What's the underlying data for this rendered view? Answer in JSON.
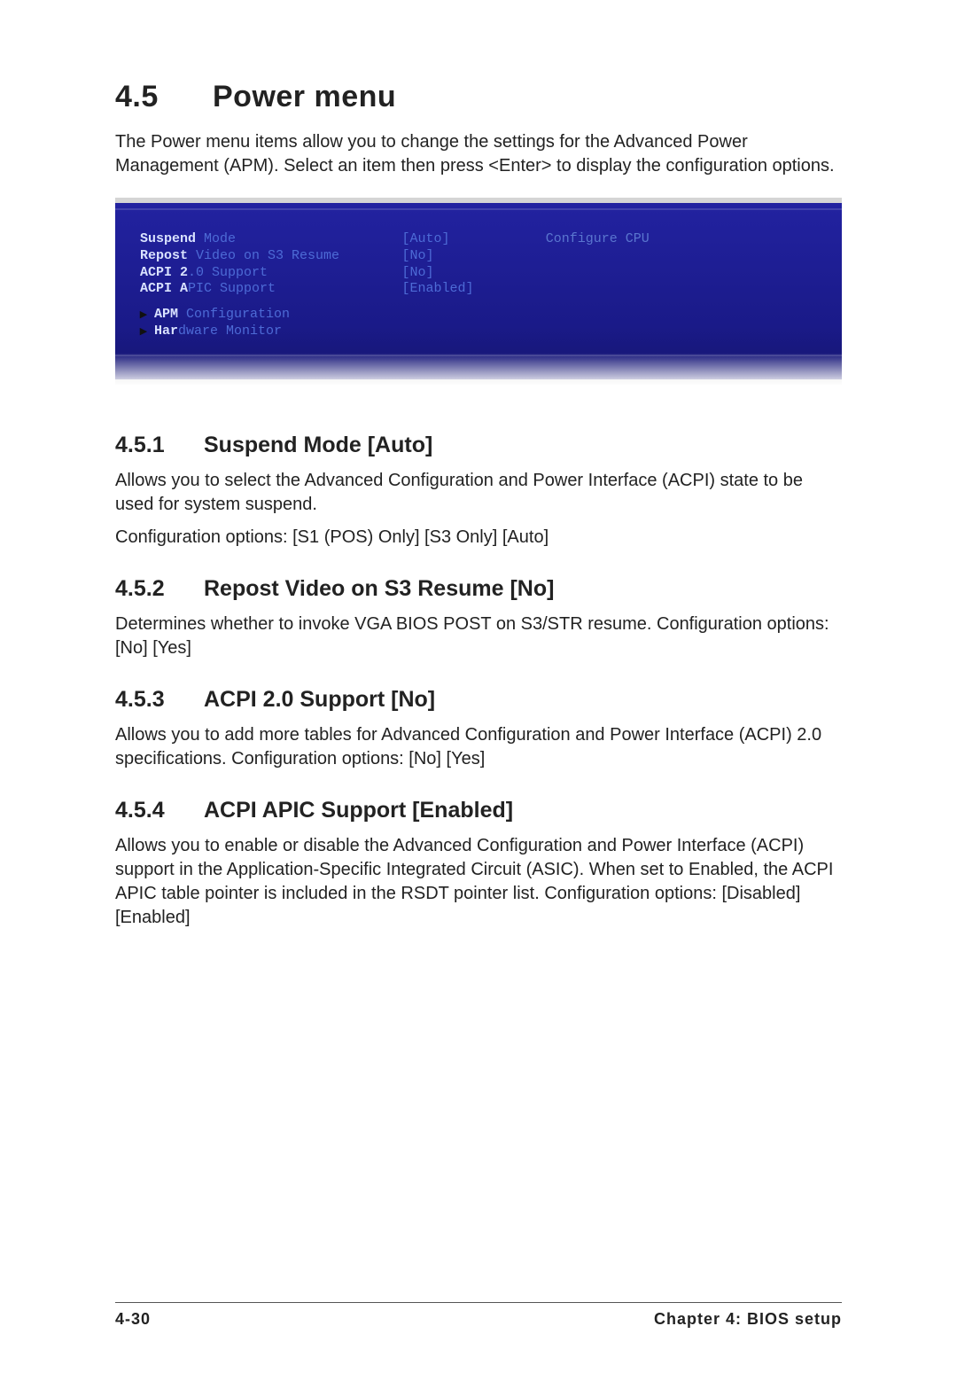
{
  "section": {
    "number": "4.5",
    "title": "Power menu",
    "intro": "The Power menu items allow you to change the settings for the Advanced Power Management (APM). Select an item then press <Enter> to display the configuration options."
  },
  "bios": {
    "help": "Configure CPU",
    "items": [
      {
        "bold": "Suspend",
        "rest": " Mode",
        "value": "[Auto]"
      },
      {
        "bold": "Repost",
        "rest": " Video on S3 Resume",
        "value": "[No]"
      },
      {
        "bold": "ACPI 2",
        "rest": ".0 Support",
        "value": "[No]"
      },
      {
        "bold": "ACPI A",
        "rest": "PIC Support",
        "value": "[Enabled]"
      }
    ],
    "submenus": [
      {
        "bold": "APM",
        "rest": " Configuration"
      },
      {
        "bold": "Har",
        "rest": "dware Monitor"
      }
    ]
  },
  "subsections": [
    {
      "num": "4.5.1",
      "title": "Suspend Mode [Auto]",
      "paras": [
        "Allows you to select the Advanced Configuration and Power Interface (ACPI) state to be used for system suspend.",
        "Configuration options: [S1 (POS) Only] [S3 Only] [Auto]"
      ]
    },
    {
      "num": "4.5.2",
      "title": "Repost Video on S3 Resume [No]",
      "paras": [
        "Determines whether to invoke VGA BIOS POST on S3/STR resume. Configuration options: [No] [Yes]"
      ]
    },
    {
      "num": "4.5.3",
      "title": "ACPI 2.0 Support [No]",
      "paras": [
        "Allows you to add more tables for Advanced Configuration and Power Interface (ACPI) 2.0 specifications. Configuration options: [No] [Yes]"
      ]
    },
    {
      "num": "4.5.4",
      "title": "ACPI APIC Support [Enabled]",
      "paras": [
        "Allows you to enable or disable the Advanced Configuration and Power Interface (ACPI) support in the Application-Specific Integrated Circuit (ASIC). When set to Enabled, the ACPI APIC table pointer is included in the RSDT pointer list. Configuration options: [Disabled] [Enabled]"
      ]
    }
  ],
  "footer": {
    "left": "4-30",
    "right": "Chapter 4: BIOS setup"
  }
}
